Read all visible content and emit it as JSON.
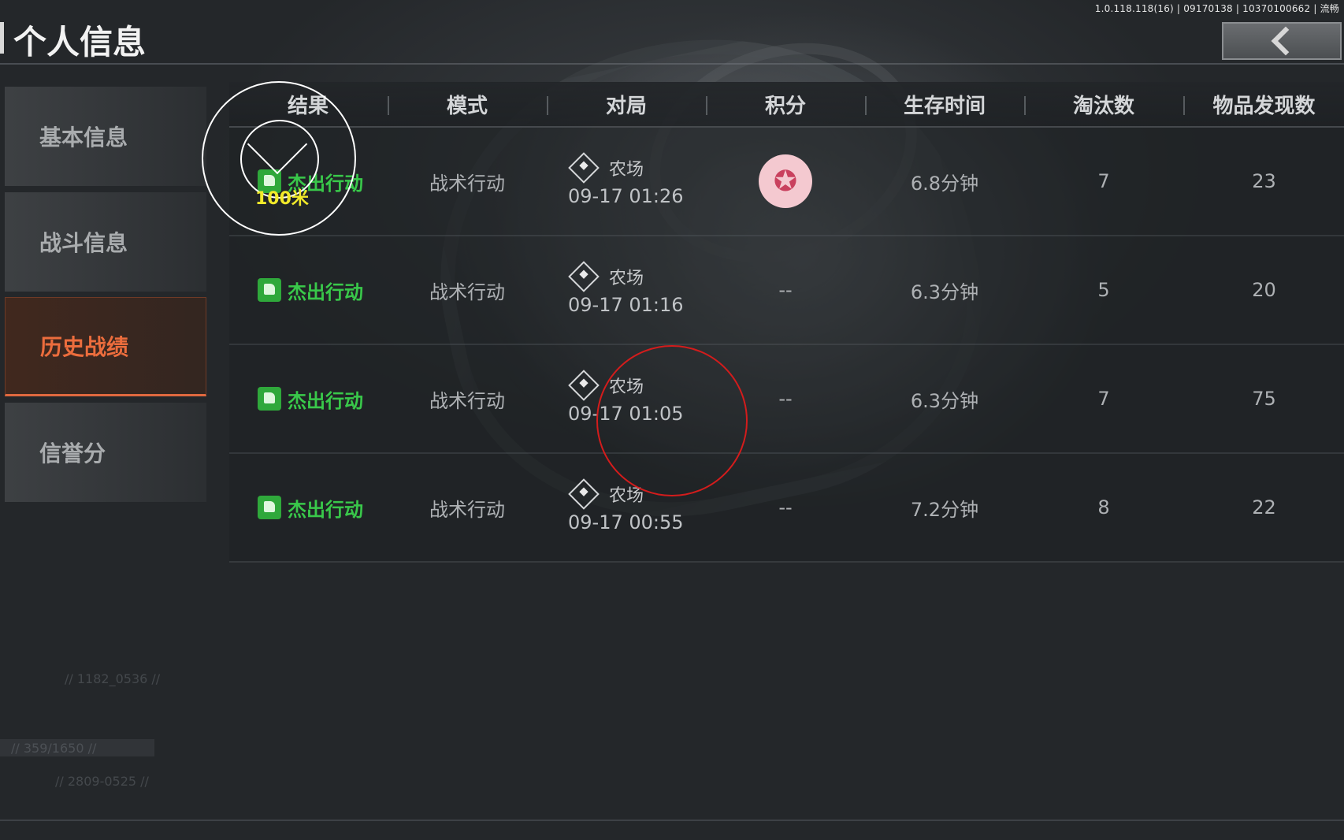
{
  "version": "1.0.118.118(16) | 09170138 | 10370100662 | 流畅",
  "page_title": "个人信息",
  "sidebar": {
    "items": [
      {
        "label": "基本信息"
      },
      {
        "label": "战斗信息"
      },
      {
        "label": "历史战绩",
        "active": true
      },
      {
        "label": "信誉分"
      }
    ]
  },
  "table": {
    "headers": [
      "结果",
      "模式",
      "对局",
      "积分",
      "生存时间",
      "淘汰数",
      "物品发现数"
    ],
    "rows": [
      {
        "result": "杰出行动",
        "mode": "战术行动",
        "map": "农场",
        "time": "09-17 01:26",
        "score": "",
        "survival": "6.8分钟",
        "eliminations": "7",
        "items_found": "23"
      },
      {
        "result": "杰出行动",
        "mode": "战术行动",
        "map": "农场",
        "time": "09-17 01:16",
        "score": "--",
        "survival": "6.3分钟",
        "eliminations": "5",
        "items_found": "20"
      },
      {
        "result": "杰出行动",
        "mode": "战术行动",
        "map": "农场",
        "time": "09-17 01:05",
        "score": "--",
        "survival": "6.3分钟",
        "eliminations": "7",
        "items_found": "75"
      },
      {
        "result": "杰出行动",
        "mode": "战术行动",
        "map": "农场",
        "time": "09-17 00:55",
        "score": "--",
        "survival": "7.2分钟",
        "eliminations": "8",
        "items_found": "22"
      }
    ]
  },
  "overlay": {
    "distance_label": "100米"
  },
  "faint_text": {
    "a": "// 1182_0536 //",
    "b": "// 359/1650 //",
    "c": "// 2809-0525 //"
  },
  "colors": {
    "accent": "#ec6d3d",
    "success": "#39c84a",
    "overlay_marker": "#f2ea2a",
    "red_circle": "#d41c1c"
  }
}
